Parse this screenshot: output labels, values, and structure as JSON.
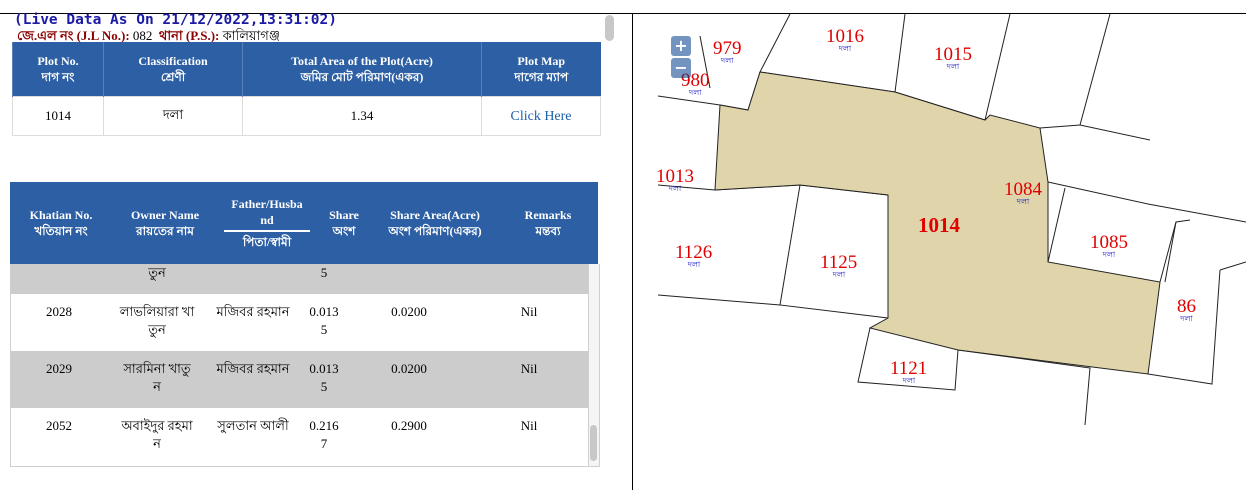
{
  "header": {
    "live": "(Live Data As On 21/12/2022,13:31:02)",
    "jl_label": "জে.এল নং (J.L No.):",
    "jl_value": "082",
    "ps_label": "থানা (P.S.):",
    "ps_value": "কালিয়াগঞ্জ"
  },
  "plot_table": {
    "headers": [
      [
        "Plot No.",
        "দাগ নং"
      ],
      [
        "Classification",
        "শ্রেণী"
      ],
      [
        "Total Area of the Plot(Acre)",
        "জমির মোট পরিমাণ(একর)"
      ],
      [
        "Plot Map",
        "দাগের ম্যাপ"
      ]
    ],
    "row": {
      "plot_no": "1014",
      "classification": "দলা",
      "area": "1.34",
      "map_link": "Click Here"
    }
  },
  "owner_table": {
    "headers": {
      "khatian": [
        "Khatian No.",
        "খতিয়ান নং"
      ],
      "owner": [
        "Owner Name",
        "রায়তের নাম"
      ],
      "father": [
        "Father/Husba",
        "nd",
        "পিতা/স্বামী"
      ],
      "share": [
        "Share",
        "অংশ"
      ],
      "share_area": [
        "Share Area(Acre)",
        "অংশ পরিমাণ(একর)"
      ],
      "remarks": [
        "Remarks",
        "মন্তব্য"
      ]
    },
    "partial_row": {
      "owner": "তুন",
      "share": "5"
    },
    "rows": [
      {
        "khatian": "2028",
        "owner": [
          "লাভলিয়ারা খা",
          "তুন"
        ],
        "father": "মজিবর রহমান",
        "share": [
          "0.013",
          "5"
        ],
        "share_area": "0.0200",
        "remarks": "Nil"
      },
      {
        "khatian": "2029",
        "owner": [
          "সারমিনা খাতু",
          "ন"
        ],
        "father": "মজিবর রহমান",
        "share": [
          "0.013",
          "5"
        ],
        "share_area": "0.0200",
        "remarks": "Nil"
      },
      {
        "khatian": "2052",
        "owner": [
          "অবাইদুর রহমা",
          "ন"
        ],
        "father": "সুলতান আলী",
        "share": [
          "0.216",
          "7"
        ],
        "share_area": "0.2900",
        "remarks": "Nil"
      }
    ]
  },
  "map": {
    "zoom_in": "+",
    "zoom_out": "−",
    "highlight_fill": "#e0d5aa",
    "label_color": "#e00000",
    "class_color": "#1a1ac8",
    "plots": [
      {
        "no": "979",
        "cls": "দলা"
      },
      {
        "no": "980",
        "cls": "দলা"
      },
      {
        "no": "1016",
        "cls": "দলা"
      },
      {
        "no": "1015",
        "cls": "দলা"
      },
      {
        "no": "1013",
        "cls": "দলা"
      },
      {
        "no": "1084",
        "cls": "দলা"
      },
      {
        "no": "1014",
        "cls": ""
      },
      {
        "no": "1126",
        "cls": "দলা"
      },
      {
        "no": "1125",
        "cls": "দলা"
      },
      {
        "no": "1085",
        "cls": "দলা"
      },
      {
        "no": "86",
        "cls": "দলা"
      },
      {
        "no": "1121",
        "cls": "দলা"
      }
    ]
  }
}
